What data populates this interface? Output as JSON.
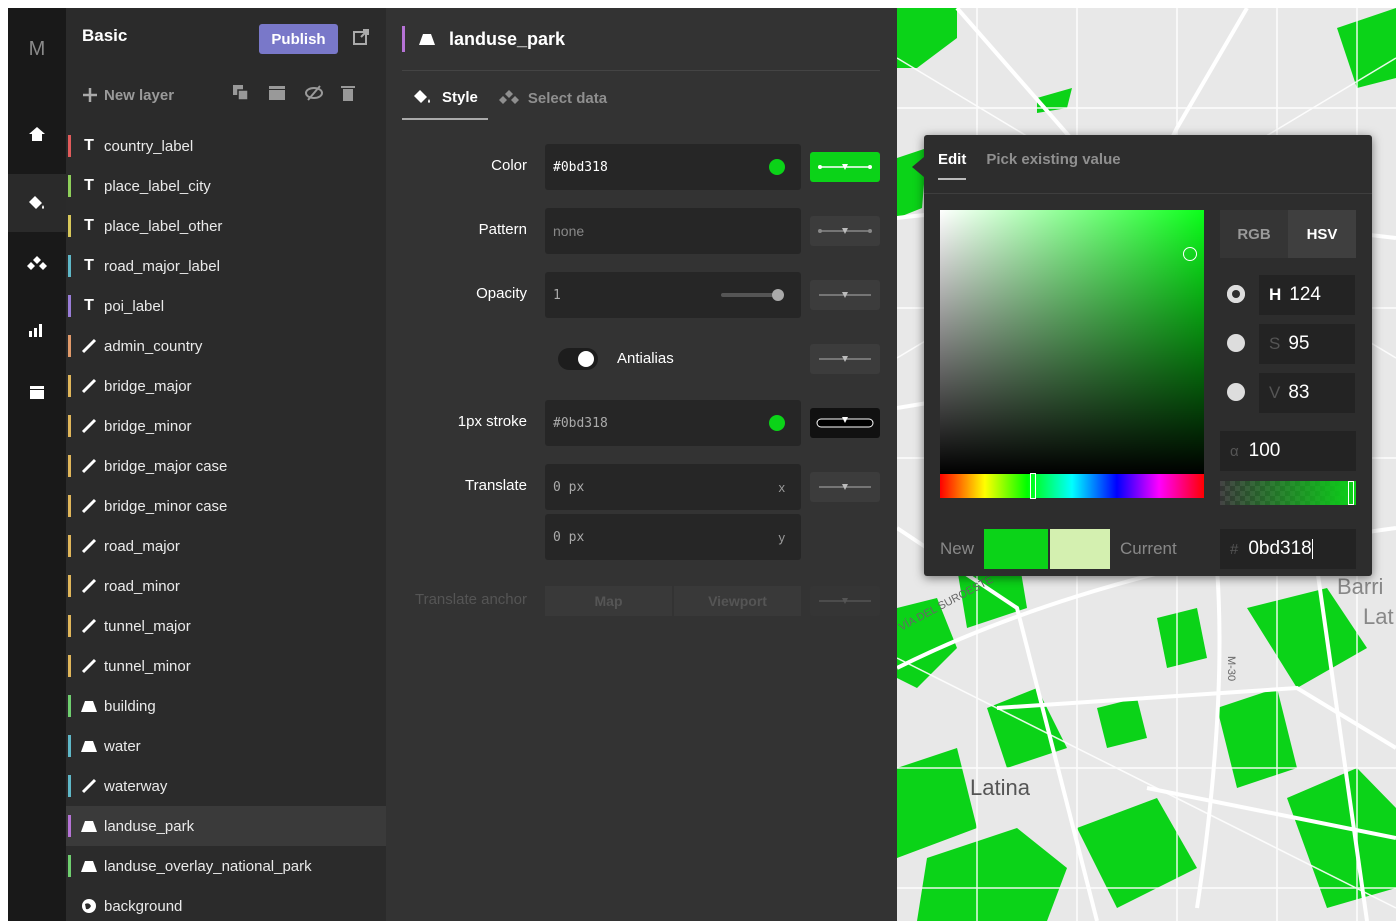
{
  "app": {
    "logo": "M"
  },
  "rail": {
    "items": [
      "home-icon",
      "paint-bucket-icon",
      "sources-icon",
      "chart-icon",
      "folder-icon"
    ]
  },
  "project": {
    "name": "Basic",
    "publish_label": "Publish"
  },
  "layer_toolbar": {
    "new_layer_label": "New layer"
  },
  "layers": [
    {
      "type": "T",
      "name": "country_label",
      "color": "#e15b5b"
    },
    {
      "type": "T",
      "name": "place_label_city",
      "color": "#8ecf5a"
    },
    {
      "type": "T",
      "name": "place_label_other",
      "color": "#d8c85a"
    },
    {
      "type": "T",
      "name": "road_major_label",
      "color": "#5fb8c8"
    },
    {
      "type": "T",
      "name": "poi_label",
      "color": "#9a7dd8"
    },
    {
      "type": "line",
      "name": "admin_country",
      "color": "#e19a6a"
    },
    {
      "type": "line",
      "name": "bridge_major",
      "color": "#e0b65a"
    },
    {
      "type": "line",
      "name": "bridge_minor",
      "color": "#e0b65a"
    },
    {
      "type": "line",
      "name": "bridge_major case",
      "color": "#e0b65a"
    },
    {
      "type": "line",
      "name": "bridge_minor case",
      "color": "#e0b65a"
    },
    {
      "type": "line",
      "name": "road_major",
      "color": "#e0b65a"
    },
    {
      "type": "line",
      "name": "road_minor",
      "color": "#e0b65a"
    },
    {
      "type": "line",
      "name": "tunnel_major",
      "color": "#e0b65a"
    },
    {
      "type": "line",
      "name": "tunnel_minor",
      "color": "#e0b65a"
    },
    {
      "type": "fill",
      "name": "building",
      "color": "#6fcf6f"
    },
    {
      "type": "fill",
      "name": "water",
      "color": "#5fb8c8"
    },
    {
      "type": "line",
      "name": "waterway",
      "color": "#5fb8c8"
    },
    {
      "type": "fill",
      "name": "landuse_park",
      "color": "#b673d6",
      "selected": true
    },
    {
      "type": "fill",
      "name": "landuse_overlay_national_park",
      "color": "#6fcf6f"
    },
    {
      "type": "bg",
      "name": "background",
      "color": "#2b2b2b"
    }
  ],
  "editor": {
    "layer_name": "landuse_park",
    "tabs": {
      "style": "Style",
      "select_data": "Select data"
    },
    "labels": {
      "color": "Color",
      "pattern": "Pattern",
      "opacity": "Opacity",
      "antialias": "Antialias",
      "stroke": "1px stroke",
      "translate": "Translate",
      "translate_anchor": "Translate anchor"
    },
    "values": {
      "color": "#0bd318",
      "pattern": "none",
      "opacity": "1",
      "stroke": "#0bd318",
      "translate_x": "0 px",
      "translate_y": "0 px",
      "axis_x": "x",
      "axis_y": "y"
    },
    "anchor_options": [
      "Map",
      "Viewport"
    ]
  },
  "picker": {
    "tabs": {
      "edit": "Edit",
      "existing": "Pick existing value"
    },
    "modes": {
      "rgb": "RGB",
      "hsv": "HSV"
    },
    "h_label": "H",
    "h": "124",
    "s_label": "S",
    "s": "95",
    "v_label": "V",
    "v": "83",
    "alpha_label": "α",
    "alpha": "100",
    "new_label": "New",
    "current_label": "Current",
    "hex_label": "#",
    "hex": "0bd318"
  },
  "map": {
    "labels": [
      "Latina",
      "VÍA DEL SUROESTE",
      "M-30",
      "Barri",
      "Lat"
    ]
  }
}
